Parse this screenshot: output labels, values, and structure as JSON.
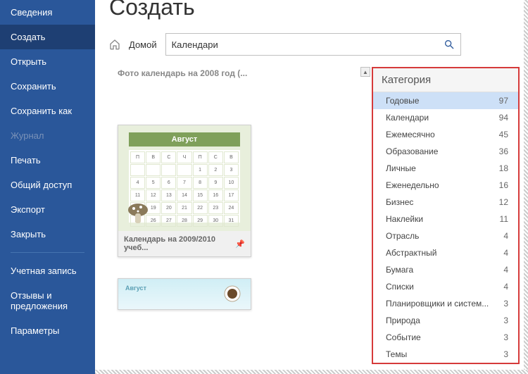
{
  "sidebar": {
    "items": [
      {
        "label": "Сведения",
        "active": false
      },
      {
        "label": "Создать",
        "active": true
      },
      {
        "label": "Открыть",
        "active": false
      },
      {
        "label": "Сохранить",
        "active": false
      },
      {
        "label": "Сохранить как",
        "active": false
      },
      {
        "label": "Журнал",
        "active": false,
        "disabled": true
      },
      {
        "label": "Печать",
        "active": false
      },
      {
        "label": "Общий доступ",
        "active": false
      },
      {
        "label": "Экспорт",
        "active": false
      },
      {
        "label": "Закрыть",
        "active": false
      }
    ],
    "footer": [
      {
        "label": "Учетная запись"
      },
      {
        "label": "Отзывы и предложения"
      },
      {
        "label": "Параметры"
      }
    ]
  },
  "page_title": "Создать",
  "breadcrumb": {
    "home": "Домой"
  },
  "search": {
    "value": "Календари"
  },
  "templates": [
    {
      "caption": "Фото календарь на 2008 год (...",
      "month": "Август",
      "label": "Календарь на 2009/2010 учеб..."
    },
    {
      "mini_label": "Август"
    }
  ],
  "category": {
    "header": "Категория",
    "items": [
      {
        "name": "Годовые",
        "count": 97,
        "selected": true
      },
      {
        "name": "Календари",
        "count": 94
      },
      {
        "name": "Ежемесячно",
        "count": 45
      },
      {
        "name": "Образование",
        "count": 36
      },
      {
        "name": "Личные",
        "count": 18
      },
      {
        "name": "Еженедельно",
        "count": 16
      },
      {
        "name": "Бизнес",
        "count": 12
      },
      {
        "name": "Наклейки",
        "count": 11
      },
      {
        "name": "Отрасль",
        "count": 4
      },
      {
        "name": "Абстрактный",
        "count": 4
      },
      {
        "name": "Бумага",
        "count": 4
      },
      {
        "name": "Списки",
        "count": 4
      },
      {
        "name": "Планировщики и систем...",
        "count": 3
      },
      {
        "name": "Природа",
        "count": 3
      },
      {
        "name": "Событие",
        "count": 3
      },
      {
        "name": "Темы",
        "count": 3
      }
    ]
  }
}
